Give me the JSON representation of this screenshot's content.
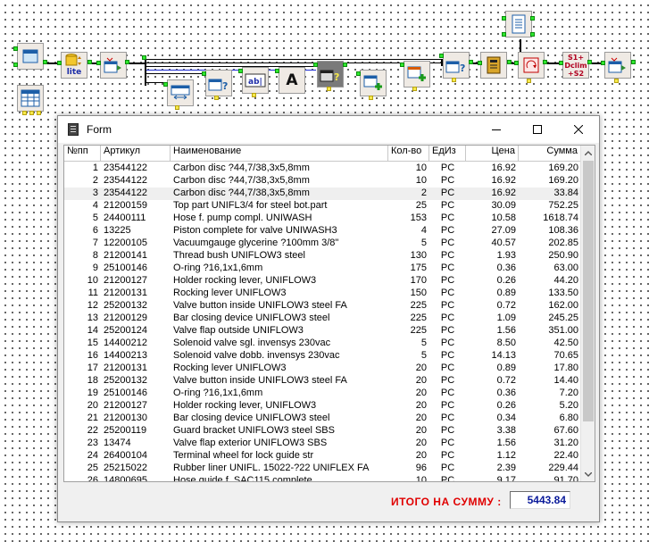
{
  "window": {
    "title": "Form"
  },
  "diagram": {
    "label_lite": "lite",
    "label_text_a": "A",
    "label_ab": "ab|",
    "label_strcat": "S1+ Dclim +S2"
  },
  "grid": {
    "columns": [
      "№пп",
      "Артикул",
      "Наименование",
      "Кол-во",
      "ЕдИз",
      "Цена",
      "Сумма"
    ],
    "rows": [
      [
        "1",
        "23544122",
        "Carbon disc ?44,7/38,3x5,8mm",
        "10",
        "PC",
        "16.92",
        "169.20"
      ],
      [
        "2",
        "23544122",
        "Carbon disc ?44,7/38,3x5,8mm",
        "10",
        "PC",
        "16.92",
        "169.20"
      ],
      [
        "3",
        "23544122",
        "Carbon disc ?44,7/38,3x5,8mm",
        "2",
        "PC",
        "16.92",
        "33.84"
      ],
      [
        "4",
        "21200159",
        "Top part UNIFL3/4 for steel bot.part",
        "25",
        "PC",
        "30.09",
        "752.25"
      ],
      [
        "5",
        "24400111",
        "Hose f. pump compl. UNIWASH",
        "153",
        "PC",
        "10.58",
        "1618.74"
      ],
      [
        "6",
        "13225",
        "Piston complete for valve UNIWASH3",
        "4",
        "PC",
        "27.09",
        "108.36"
      ],
      [
        "7",
        "12200105",
        "Vacuumgauge glycerine ?100mm 3/8\"",
        "5",
        "PC",
        "40.57",
        "202.85"
      ],
      [
        "8",
        "21200141",
        "Thread bush UNIFLOW3 steel",
        "130",
        "PC",
        "1.93",
        "250.90"
      ],
      [
        "9",
        "25100146",
        "O-ring ?16,1x1,6mm",
        "175",
        "PC",
        "0.36",
        "63.00"
      ],
      [
        "10",
        "21200127",
        "Holder rocking lever, UNIFLOW3",
        "170",
        "PC",
        "0.26",
        "44.20"
      ],
      [
        "11",
        "21200131",
        "Rocking lever UNIFLOW3",
        "150",
        "PC",
        "0.89",
        "133.50"
      ],
      [
        "12",
        "25200132",
        "Valve button inside UNIFLOW3 steel FA",
        "225",
        "PC",
        "0.72",
        "162.00"
      ],
      [
        "13",
        "21200129",
        "Bar closing device UNIFLOW3 steel",
        "225",
        "PC",
        "1.09",
        "245.25"
      ],
      [
        "14",
        "25200124",
        "Valve flap outside UNIFLOW3",
        "225",
        "PC",
        "1.56",
        "351.00"
      ],
      [
        "15",
        "14400212",
        "Solenoid valve sgl. invensys 230vac",
        "5",
        "PC",
        "8.50",
        "42.50"
      ],
      [
        "16",
        "14400213",
        "Solenoid valve dobb. invensys 230vac",
        "5",
        "PC",
        "14.13",
        "70.65"
      ],
      [
        "17",
        "21200131",
        "Rocking lever UNIFLOW3",
        "20",
        "PC",
        "0.89",
        "17.80"
      ],
      [
        "18",
        "25200132",
        "Valve button inside UNIFLOW3 steel FA",
        "20",
        "PC",
        "0.72",
        "14.40"
      ],
      [
        "19",
        "25100146",
        "O-ring ?16,1x1,6mm",
        "20",
        "PC",
        "0.36",
        "7.20"
      ],
      [
        "20",
        "21200127",
        "Holder rocking lever, UNIFLOW3",
        "20",
        "PC",
        "0.26",
        "5.20"
      ],
      [
        "21",
        "21200130",
        "Bar closing device UNIFLOW3 steel",
        "20",
        "PC",
        "0.34",
        "6.80"
      ],
      [
        "22",
        "25200119",
        "Guard bracket UNIFLOW3 steel SBS",
        "20",
        "PC",
        "3.38",
        "67.60"
      ],
      [
        "23",
        "13474",
        "Valve flap exterior UNIFLOW3 SBS",
        "20",
        "PC",
        "1.56",
        "31.20"
      ],
      [
        "24",
        "26400104",
        "Terminal wheel for lock guide str",
        "20",
        "PC",
        "1.12",
        "22.40"
      ],
      [
        "25",
        "25215022",
        "Rubber liner UNIFL. 15022-?22 UNIFLEX FA",
        "96",
        "PC",
        "2.39",
        "229.44"
      ],
      [
        "26",
        "14800695",
        "Hose guide f. SAC115 complete",
        "10",
        "PC",
        "9.17",
        "91.70"
      ]
    ]
  },
  "footer": {
    "total_label": "ИТОГО НА СУММУ :",
    "total_value": "5443.84"
  }
}
